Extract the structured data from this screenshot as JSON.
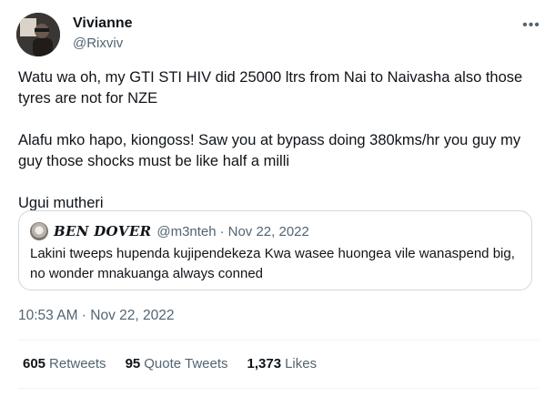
{
  "author": {
    "name": "Vivianne",
    "handle": "@Rixviv"
  },
  "more_icon": "more-horizontal-icon",
  "tweet": {
    "paragraphs": [
      "Watu wa oh, my GTI STI HIV did 25000 ltrs from Nai to Naivasha also those tyres are not for NZE",
      "Alafu mko hapo, kiongoss! Saw you at bypass doing 380kms/hr you guy my guy those shocks must be like half a milli",
      "Ugui mutheri"
    ]
  },
  "quoted_tweet": {
    "name": "𝑩𝑬𝑵 𝑫𝑶𝑽𝑬𝑹",
    "handle": "@m3nteh",
    "separator": "·",
    "date": "Nov 22, 2022",
    "text": "Lakini tweeps hupenda kujipendekeza Kwa wasee huongea vile wanaspend big, no wonder mnakuanga always conned"
  },
  "timestamp": "10:53 AM · Nov 22, 2022",
  "stats": {
    "retweets": {
      "count": "605",
      "label": "Retweets"
    },
    "quote_tweets": {
      "count": "95",
      "label": "Quote Tweets"
    },
    "likes": {
      "count": "1,373",
      "label": "Likes"
    }
  },
  "colors": {
    "text": "#0f1419",
    "secondary": "#536471",
    "border": "#cfd9de",
    "divider": "#eff3f4"
  }
}
